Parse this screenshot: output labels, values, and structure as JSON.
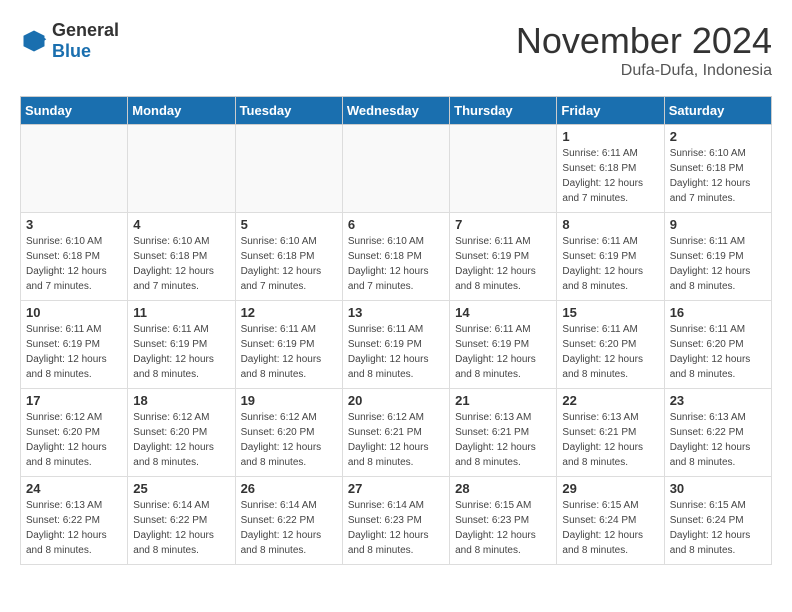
{
  "logo": {
    "general": "General",
    "blue": "Blue"
  },
  "header": {
    "month": "November 2024",
    "location": "Dufa-Dufa, Indonesia"
  },
  "weekdays": [
    "Sunday",
    "Monday",
    "Tuesday",
    "Wednesday",
    "Thursday",
    "Friday",
    "Saturday"
  ],
  "weeks": [
    [
      {
        "day": "",
        "empty": true
      },
      {
        "day": "",
        "empty": true
      },
      {
        "day": "",
        "empty": true
      },
      {
        "day": "",
        "empty": true
      },
      {
        "day": "",
        "empty": true
      },
      {
        "day": "1",
        "sunrise": "6:11 AM",
        "sunset": "6:18 PM",
        "daylight": "12 hours and 7 minutes."
      },
      {
        "day": "2",
        "sunrise": "6:10 AM",
        "sunset": "6:18 PM",
        "daylight": "12 hours and 7 minutes."
      }
    ],
    [
      {
        "day": "3",
        "sunrise": "6:10 AM",
        "sunset": "6:18 PM",
        "daylight": "12 hours and 7 minutes."
      },
      {
        "day": "4",
        "sunrise": "6:10 AM",
        "sunset": "6:18 PM",
        "daylight": "12 hours and 7 minutes."
      },
      {
        "day": "5",
        "sunrise": "6:10 AM",
        "sunset": "6:18 PM",
        "daylight": "12 hours and 7 minutes."
      },
      {
        "day": "6",
        "sunrise": "6:10 AM",
        "sunset": "6:18 PM",
        "daylight": "12 hours and 7 minutes."
      },
      {
        "day": "7",
        "sunrise": "6:11 AM",
        "sunset": "6:19 PM",
        "daylight": "12 hours and 8 minutes."
      },
      {
        "day": "8",
        "sunrise": "6:11 AM",
        "sunset": "6:19 PM",
        "daylight": "12 hours and 8 minutes."
      },
      {
        "day": "9",
        "sunrise": "6:11 AM",
        "sunset": "6:19 PM",
        "daylight": "12 hours and 8 minutes."
      }
    ],
    [
      {
        "day": "10",
        "sunrise": "6:11 AM",
        "sunset": "6:19 PM",
        "daylight": "12 hours and 8 minutes."
      },
      {
        "day": "11",
        "sunrise": "6:11 AM",
        "sunset": "6:19 PM",
        "daylight": "12 hours and 8 minutes."
      },
      {
        "day": "12",
        "sunrise": "6:11 AM",
        "sunset": "6:19 PM",
        "daylight": "12 hours and 8 minutes."
      },
      {
        "day": "13",
        "sunrise": "6:11 AM",
        "sunset": "6:19 PM",
        "daylight": "12 hours and 8 minutes."
      },
      {
        "day": "14",
        "sunrise": "6:11 AM",
        "sunset": "6:19 PM",
        "daylight": "12 hours and 8 minutes."
      },
      {
        "day": "15",
        "sunrise": "6:11 AM",
        "sunset": "6:20 PM",
        "daylight": "12 hours and 8 minutes."
      },
      {
        "day": "16",
        "sunrise": "6:11 AM",
        "sunset": "6:20 PM",
        "daylight": "12 hours and 8 minutes."
      }
    ],
    [
      {
        "day": "17",
        "sunrise": "6:12 AM",
        "sunset": "6:20 PM",
        "daylight": "12 hours and 8 minutes."
      },
      {
        "day": "18",
        "sunrise": "6:12 AM",
        "sunset": "6:20 PM",
        "daylight": "12 hours and 8 minutes."
      },
      {
        "day": "19",
        "sunrise": "6:12 AM",
        "sunset": "6:20 PM",
        "daylight": "12 hours and 8 minutes."
      },
      {
        "day": "20",
        "sunrise": "6:12 AM",
        "sunset": "6:21 PM",
        "daylight": "12 hours and 8 minutes."
      },
      {
        "day": "21",
        "sunrise": "6:13 AM",
        "sunset": "6:21 PM",
        "daylight": "12 hours and 8 minutes."
      },
      {
        "day": "22",
        "sunrise": "6:13 AM",
        "sunset": "6:21 PM",
        "daylight": "12 hours and 8 minutes."
      },
      {
        "day": "23",
        "sunrise": "6:13 AM",
        "sunset": "6:22 PM",
        "daylight": "12 hours and 8 minutes."
      }
    ],
    [
      {
        "day": "24",
        "sunrise": "6:13 AM",
        "sunset": "6:22 PM",
        "daylight": "12 hours and 8 minutes."
      },
      {
        "day": "25",
        "sunrise": "6:14 AM",
        "sunset": "6:22 PM",
        "daylight": "12 hours and 8 minutes."
      },
      {
        "day": "26",
        "sunrise": "6:14 AM",
        "sunset": "6:22 PM",
        "daylight": "12 hours and 8 minutes."
      },
      {
        "day": "27",
        "sunrise": "6:14 AM",
        "sunset": "6:23 PM",
        "daylight": "12 hours and 8 minutes."
      },
      {
        "day": "28",
        "sunrise": "6:15 AM",
        "sunset": "6:23 PM",
        "daylight": "12 hours and 8 minutes."
      },
      {
        "day": "29",
        "sunrise": "6:15 AM",
        "sunset": "6:24 PM",
        "daylight": "12 hours and 8 minutes."
      },
      {
        "day": "30",
        "sunrise": "6:15 AM",
        "sunset": "6:24 PM",
        "daylight": "12 hours and 8 minutes."
      }
    ]
  ],
  "labels": {
    "sunrise": "Sunrise:",
    "sunset": "Sunset:",
    "daylight": "Daylight:"
  }
}
